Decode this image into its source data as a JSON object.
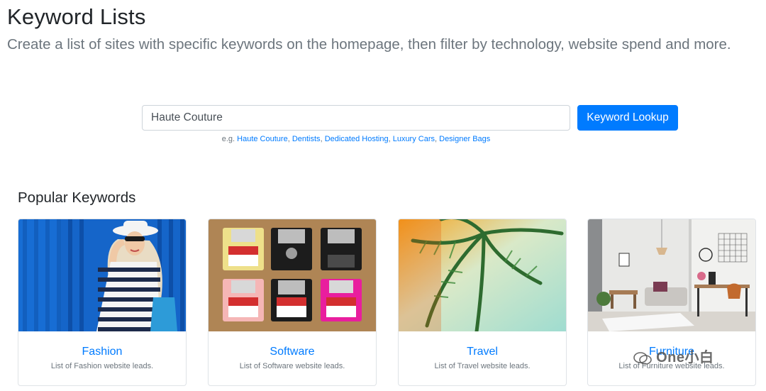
{
  "header": {
    "title": "Keyword Lists",
    "subtitle": "Create a list of sites with specific keywords on the homepage, then filter by technology, website spend and more."
  },
  "search": {
    "value": "Haute Couture",
    "button_label": "Keyword Lookup",
    "examples_prefix": "e.g.",
    "examples": [
      "Haute Couture",
      "Dentists",
      "Dedicated Hosting",
      "Luxury Cars",
      "Designer Bags"
    ]
  },
  "popular": {
    "title": "Popular Keywords",
    "cards": [
      {
        "title": "Fashion",
        "description": "List of Fashion website leads."
      },
      {
        "title": "Software",
        "description": "List of Software website leads."
      },
      {
        "title": "Travel",
        "description": "List of Travel website leads."
      },
      {
        "title": "Furniture",
        "description": "List of Furniture website leads."
      }
    ]
  },
  "watermark": {
    "text": "One小白"
  },
  "colors": {
    "accent": "#007bff",
    "muted": "#6c757d"
  }
}
